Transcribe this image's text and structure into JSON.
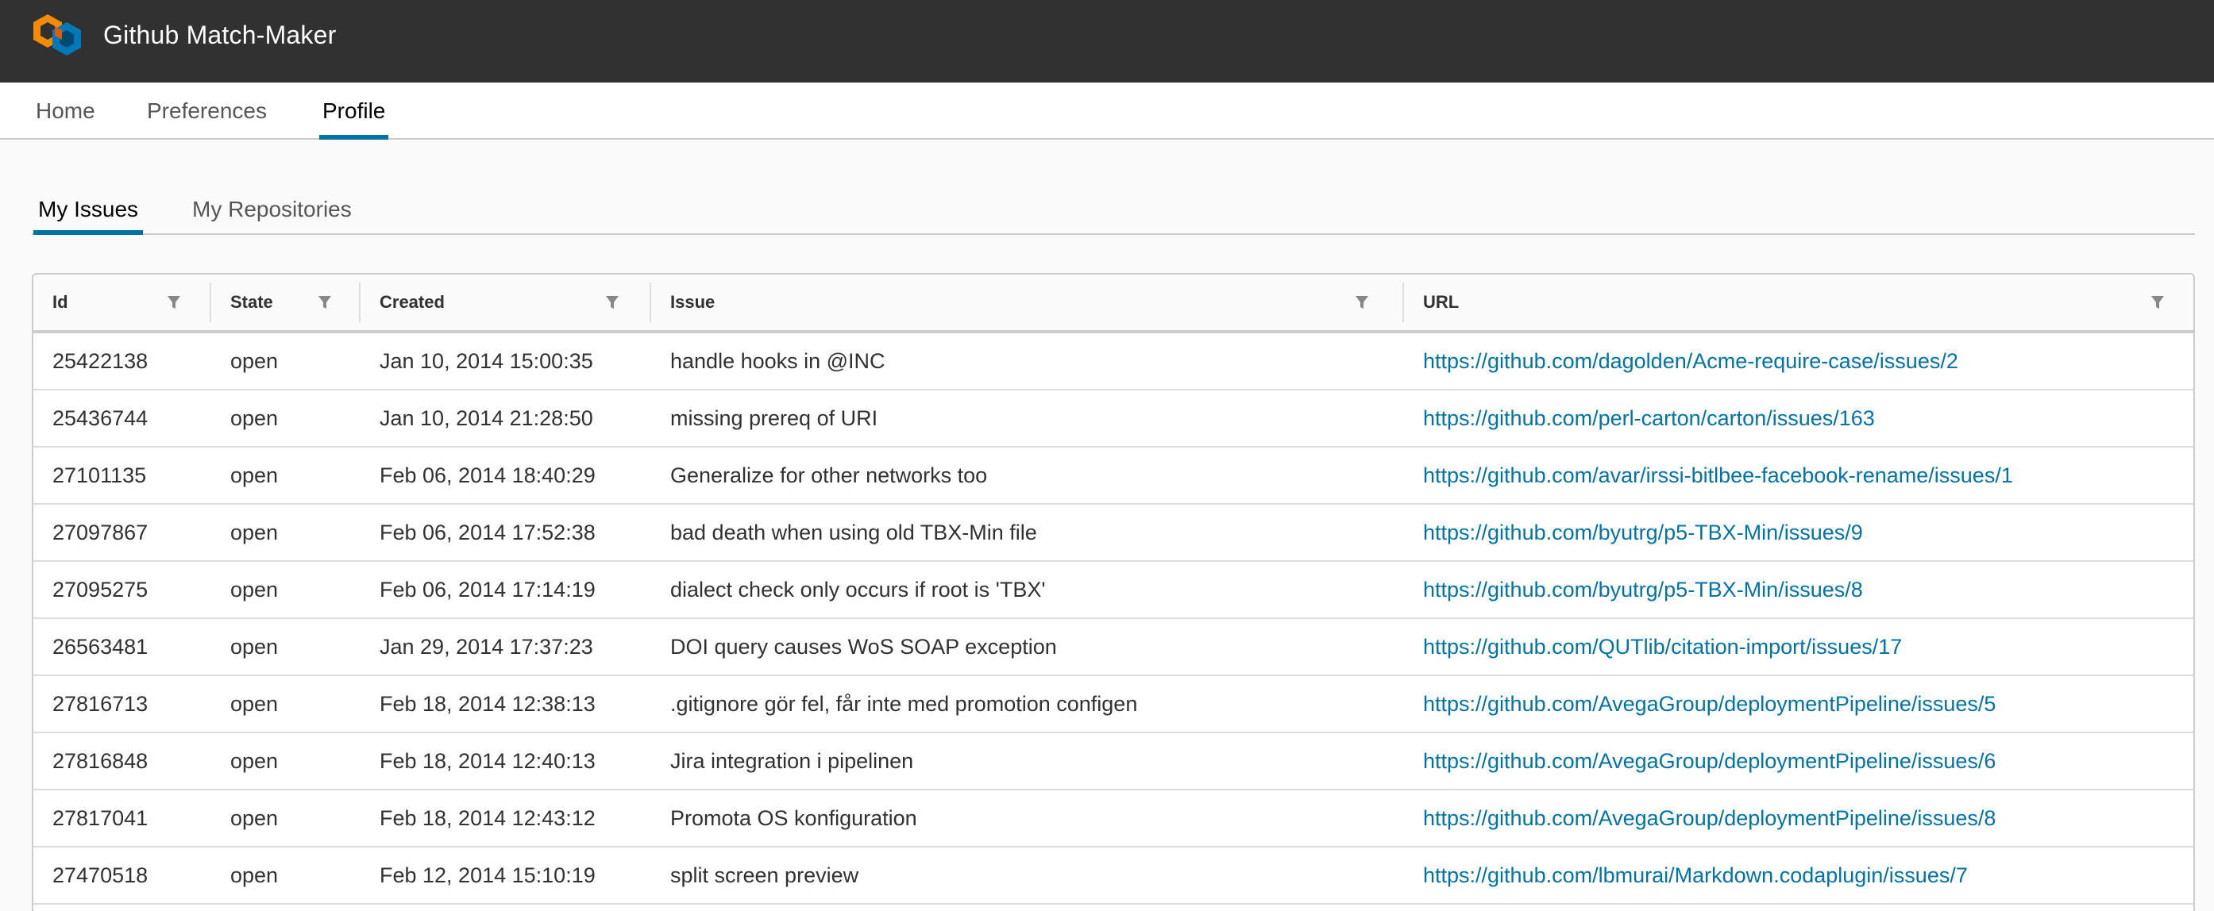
{
  "app": {
    "title": "Github Match-Maker",
    "logo_icon": "hexagon-cube-logo-icon",
    "colors": {
      "header_bg": "#313131",
      "accent": "#0072a3",
      "logo_orange": "#f38b00",
      "logo_blue": "#0079b8"
    }
  },
  "topnav": {
    "tabs": [
      {
        "label": "Home",
        "active": false
      },
      {
        "label": "Preferences",
        "active": false
      },
      {
        "label": "Profile",
        "active": true
      }
    ]
  },
  "subnav": {
    "tabs": [
      {
        "label": "My Issues",
        "active": true
      },
      {
        "label": "My Repositories",
        "active": false
      }
    ]
  },
  "grid": {
    "filter_icon": "filter-funnel-icon",
    "columns": [
      "Id",
      "State",
      "Created",
      "Issue",
      "URL"
    ],
    "rows": [
      {
        "id": "25422138",
        "state": "open",
        "created": "Jan 10, 2014 15:00:35",
        "issue": "handle hooks in @INC",
        "url": "https://github.com/dagolden/Acme-require-case/issues/2"
      },
      {
        "id": "25436744",
        "state": "open",
        "created": "Jan 10, 2014 21:28:50",
        "issue": "missing prereq of URI",
        "url": "https://github.com/perl-carton/carton/issues/163"
      },
      {
        "id": "27101135",
        "state": "open",
        "created": "Feb 06, 2014 18:40:29",
        "issue": "Generalize for other networks too",
        "url": "https://github.com/avar/irssi-bitlbee-facebook-rename/issues/1"
      },
      {
        "id": "27097867",
        "state": "open",
        "created": "Feb 06, 2014 17:52:38",
        "issue": "bad death when using old TBX-Min file",
        "url": "https://github.com/byutrg/p5-TBX-Min/issues/9"
      },
      {
        "id": "27095275",
        "state": "open",
        "created": "Feb 06, 2014 17:14:19",
        "issue": "dialect check only occurs if root is 'TBX'",
        "url": "https://github.com/byutrg/p5-TBX-Min/issues/8"
      },
      {
        "id": "26563481",
        "state": "open",
        "created": "Jan 29, 2014 17:37:23",
        "issue": "DOI query causes WoS SOAP exception",
        "url": "https://github.com/QUTlib/citation-import/issues/17"
      },
      {
        "id": "27816713",
        "state": "open",
        "created": "Feb 18, 2014 12:38:13",
        "issue": ".gitignore gör fel, får inte med promotion configen",
        "url": "https://github.com/AvegaGroup/deploymentPipeline/issues/5"
      },
      {
        "id": "27816848",
        "state": "open",
        "created": "Feb 18, 2014 12:40:13",
        "issue": "Jira integration i pipelinen",
        "url": "https://github.com/AvegaGroup/deploymentPipeline/issues/6"
      },
      {
        "id": "27817041",
        "state": "open",
        "created": "Feb 18, 2014 12:43:12",
        "issue": "Promota OS konfiguration",
        "url": "https://github.com/AvegaGroup/deploymentPipeline/issues/8"
      },
      {
        "id": "27470518",
        "state": "open",
        "created": "Feb 12, 2014 15:10:19",
        "issue": "split screen preview",
        "url": "https://github.com/lbmurai/Markdown.codaplugin/issues/7"
      }
    ]
  }
}
